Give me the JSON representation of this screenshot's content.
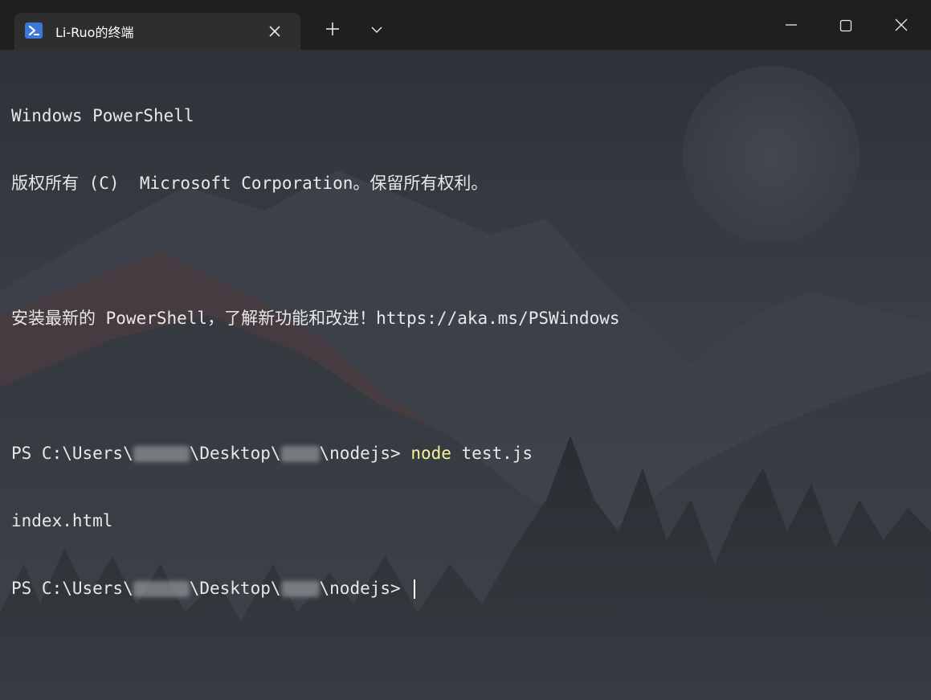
{
  "tab": {
    "title": "Li-Ruo的终端",
    "icon": "powershell-icon"
  },
  "toolbar": {
    "new_tab_icon": "plus-icon",
    "dropdown_icon": "chevron-down-icon"
  },
  "window_controls": {
    "minimize_icon": "minimize-icon",
    "maximize_icon": "maximize-icon",
    "close_icon": "close-icon"
  },
  "terminal": {
    "line1": "Windows PowerShell",
    "line2": "版权所有 (C)  Microsoft Corporation。保留所有权利。",
    "line3": "",
    "line4": "安装最新的 PowerShell，了解新功能和改进！https://aka.ms/PSWindows",
    "line5": "",
    "prompt1_prefix": "PS C:\\Users\\",
    "prompt1_mid": "\\Desktop\\",
    "prompt1_suffix": "\\nodejs> ",
    "command": "node",
    "command_args": " test.js",
    "output1": "index.html",
    "prompt2_prefix": "PS C:\\Users\\",
    "prompt2_mid": "\\Desktop\\",
    "prompt2_suffix": "\\nodejs> "
  },
  "colors": {
    "titlebar": "#1f1f1f",
    "tab": "#2e2e2e",
    "text": "#e8e8e8",
    "command": "#f5f29a",
    "accent": "#3b78d8"
  }
}
